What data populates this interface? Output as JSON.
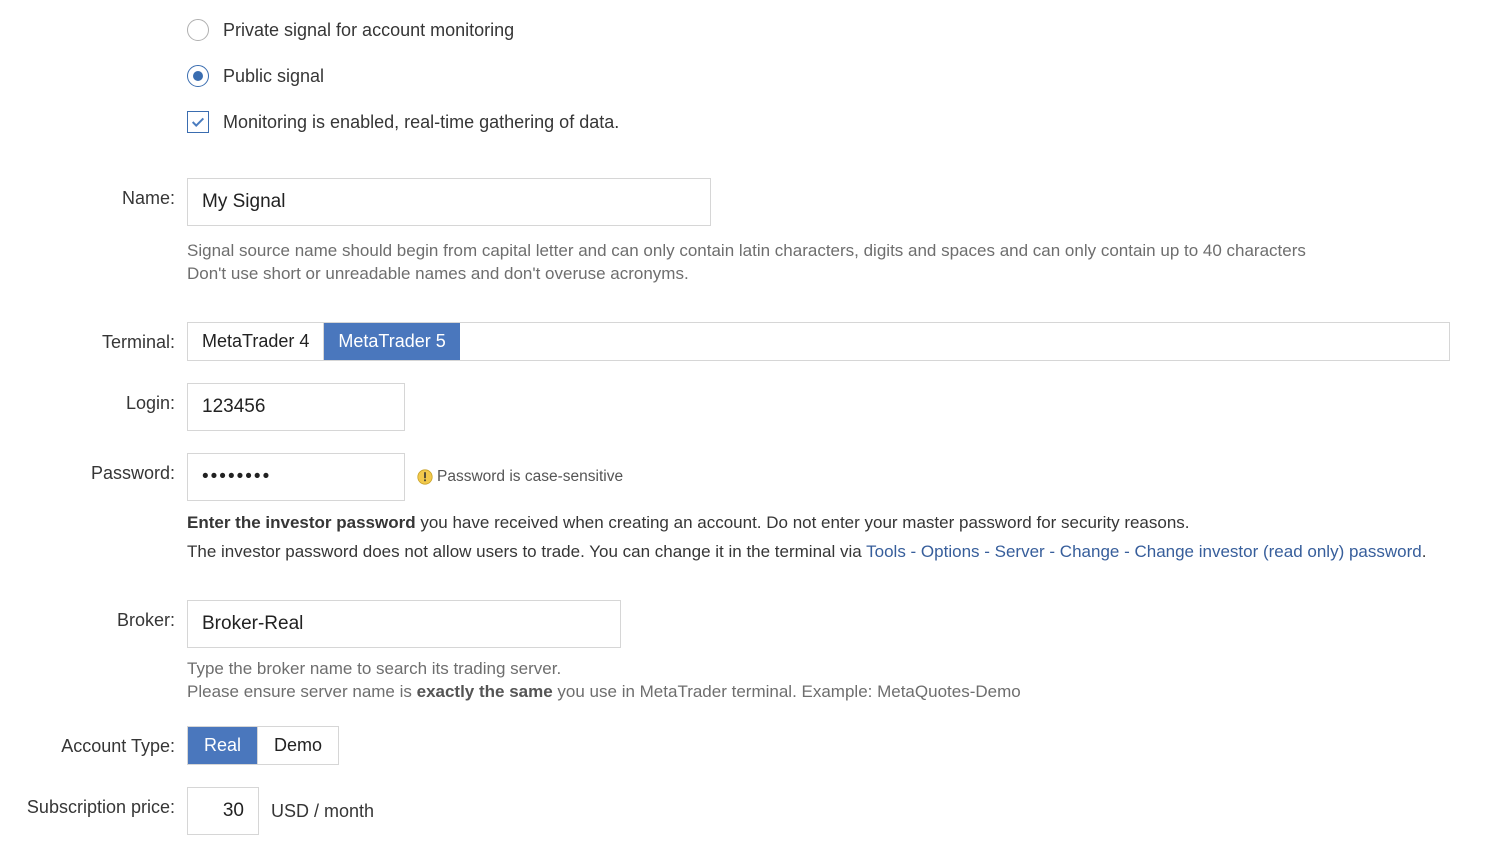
{
  "signal_type": {
    "private_label": "Private signal for account monitoring",
    "public_label": "Public signal",
    "selected": "public"
  },
  "monitoring": {
    "label": "Monitoring is enabled, real-time gathering of data.",
    "checked": true
  },
  "name": {
    "label": "Name:",
    "value": "My Signal",
    "hint": "Signal source name should begin from capital letter and can only contain latin characters, digits and spaces and can only contain up to 40 characters\nDon't use short or unreadable names and don't overuse acronyms."
  },
  "terminal": {
    "label": "Terminal:",
    "options": [
      "MetaTrader 4",
      "MetaTrader 5"
    ],
    "selected": "MetaTrader 5"
  },
  "login": {
    "label": "Login:",
    "value": "123456"
  },
  "password": {
    "label": "Password:",
    "value": "••••••••",
    "note": "Password is case-sensitive",
    "hint_strong": "Enter the investor password",
    "hint_rest": " you have received when creating an account. Do not enter your master password for security reasons.",
    "hint2_plain": "The investor password does not allow users to trade. You can change it in the terminal via ",
    "hint2_link": "Tools - Options - Server - Change - Change investor (read only) password",
    "hint2_tail": "."
  },
  "broker": {
    "label": "Broker:",
    "value": "Broker-Real",
    "hint1": "Type the broker name to search its trading server.",
    "hint2_plain1": "Please ensure server name is ",
    "hint2_strong": "exactly the same",
    "hint2_plain2": " you use in MetaTrader terminal. Example: MetaQuotes-Demo"
  },
  "account_type": {
    "label": "Account Type:",
    "options": [
      "Real",
      "Demo"
    ],
    "selected": "Real"
  },
  "subscription": {
    "label": "Subscription price:",
    "value": "30",
    "unit": "USD / month"
  }
}
